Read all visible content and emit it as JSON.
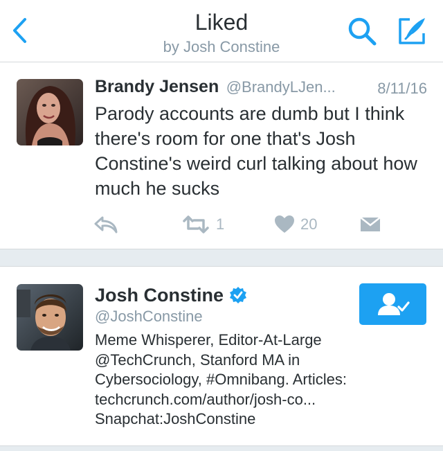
{
  "colors": {
    "accent": "#1da1f2",
    "text": "#292f33",
    "muted": "#8899a6",
    "action": "#aab8c2"
  },
  "header": {
    "title": "Liked",
    "subtitle": "by Josh Constine",
    "back_icon": "chevron-left-icon",
    "search_icon": "search-icon",
    "compose_icon": "compose-icon"
  },
  "tweet": {
    "name": "Brandy Jensen",
    "handle": "@BrandyLJen...",
    "date": "8/11/16",
    "text": "Parody accounts are dumb but I think there's room for one that's Josh Constine's weird curl talking about how much he sucks",
    "retweets": "1",
    "likes": "20",
    "icons": [
      "reply-icon",
      "retweet-icon",
      "heart-icon",
      "direct-message-icon"
    ]
  },
  "user_card": {
    "name": "Josh Constine",
    "handle": "@JoshConstine",
    "verified": true,
    "bio_lines": [
      "Meme Whisperer, Editor-At-Large",
      "@TechCrunch, Stanford MA in",
      "Cybersociology, #Omnibang. Articles:",
      "techcrunch.com/author/josh-co...",
      "Snapchat:JoshConstine"
    ],
    "follow_icon": "following-user-check-icon"
  }
}
